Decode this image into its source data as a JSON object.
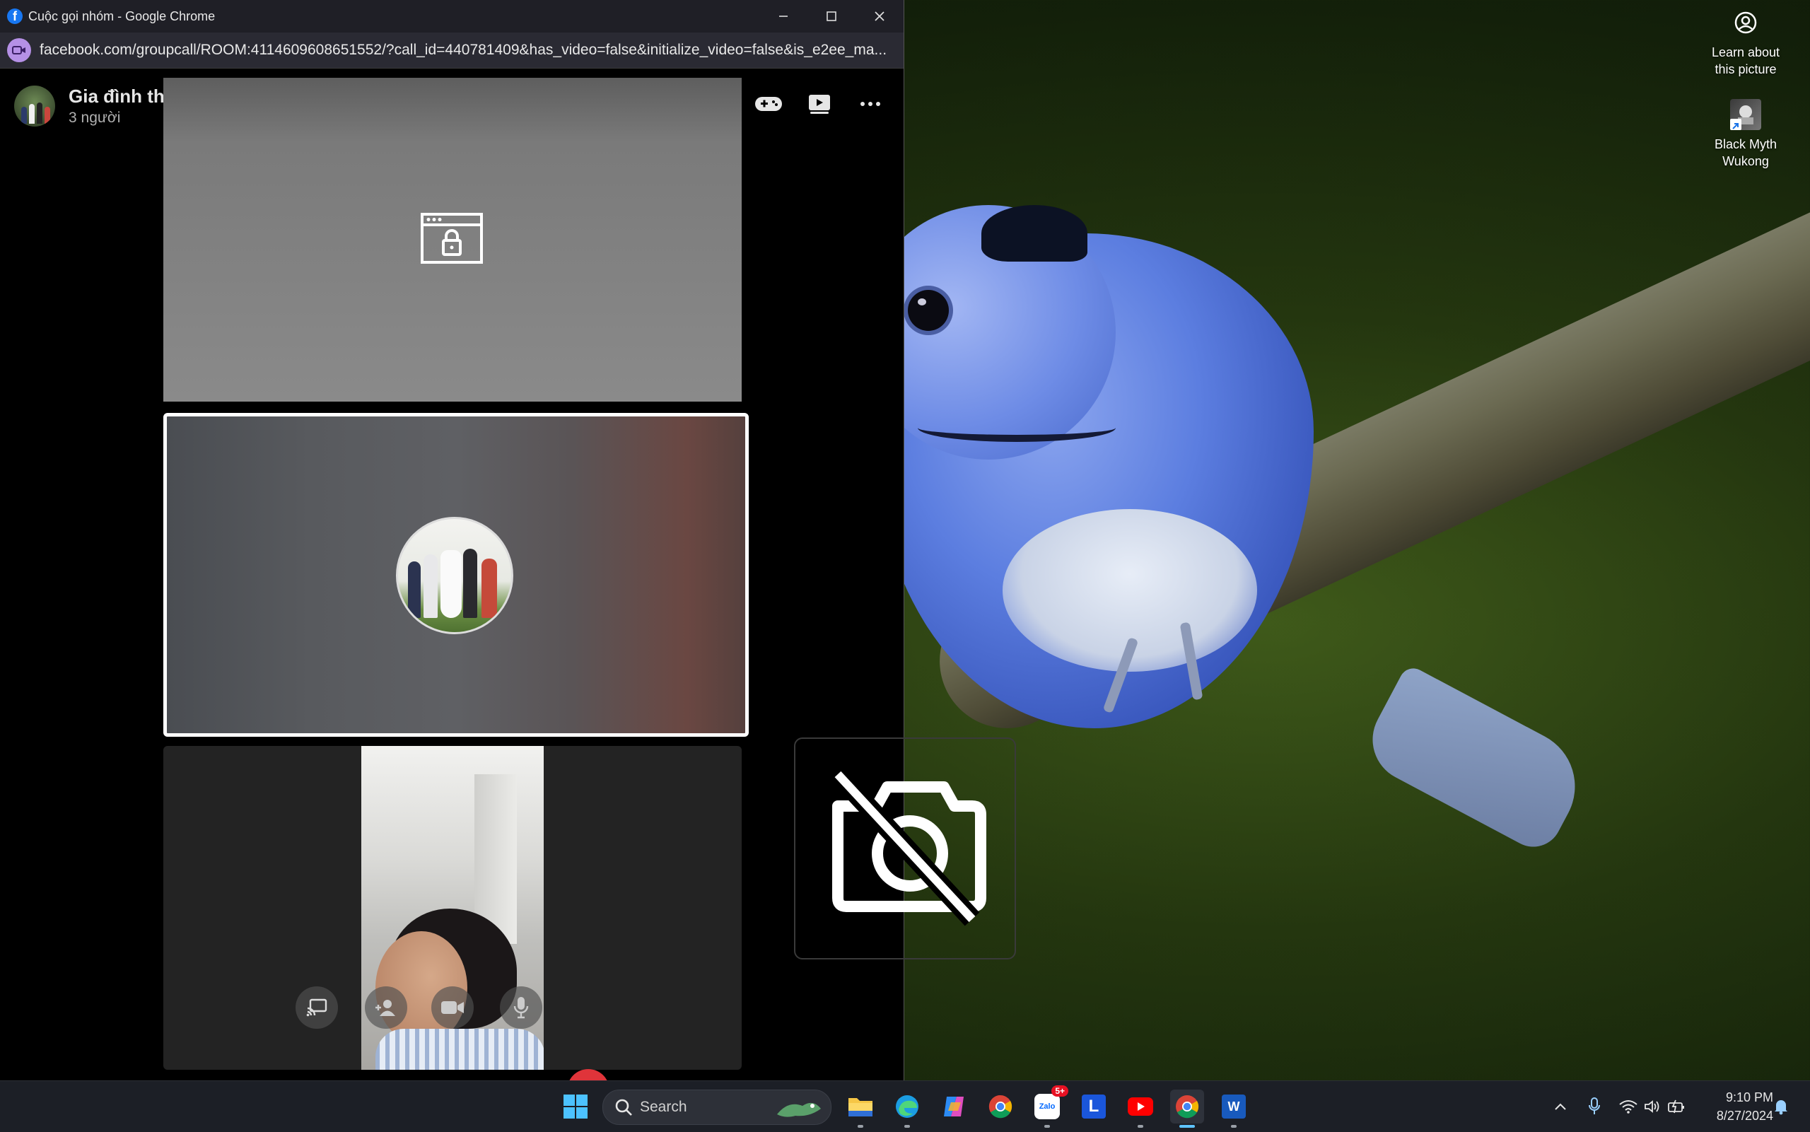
{
  "window": {
    "title": "Cuộc gọi nhóm - Google Chrome",
    "url": "facebook.com/groupcall/ROOM:4114609608651552/?call_id=440781409&has_video=false&initialize_video=false&is_e2ee_ma..."
  },
  "call": {
    "group_name": "Gia đình thân yêu 🥰🥰",
    "participant_count": "3 người"
  },
  "desktop": {
    "icons": [
      {
        "label_line1": "Learn about",
        "label_line2": "this picture",
        "icon": "camera-info-icon"
      },
      {
        "label_line1": "Black Myth",
        "label_line2": "Wukong",
        "icon": "game-shortcut-icon"
      }
    ]
  },
  "taskbar": {
    "search_label": "Search",
    "apps": [
      "start",
      "search",
      "file-explorer",
      "edge",
      "copilot",
      "chrome",
      "zalo",
      "l-app",
      "youtube",
      "chrome-active",
      "word"
    ],
    "zalo_badge": "5+",
    "l_app_letter": "L",
    "word_letter": "W",
    "zalo_letter": "Zalo",
    "time": "9:10 PM",
    "date": "8/27/2024"
  },
  "colors": {
    "end_call": "#e0343a",
    "facebook_blue": "#1877f2",
    "active_indicator": "#5ec4ff"
  }
}
